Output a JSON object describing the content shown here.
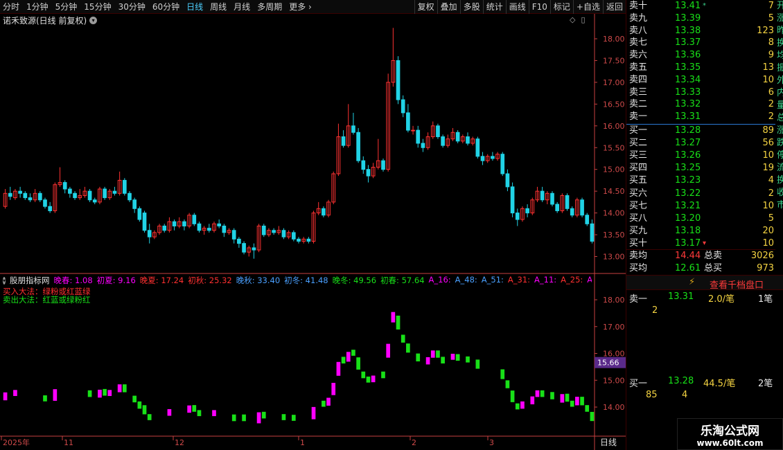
{
  "toolbar": {
    "periods": [
      "分时",
      "1分钟",
      "5分钟",
      "15分钟",
      "30分钟",
      "60分钟",
      "日线",
      "周线",
      "月线",
      "多周期",
      "更多"
    ],
    "more_arrow": "›",
    "active_period": "日线",
    "buttons": [
      "复权",
      "叠加",
      "多股",
      "统计",
      "画线",
      "F10",
      "标记",
      "+自选",
      "返回"
    ]
  },
  "stock": {
    "title": "诺禾致源(日线 前复权)"
  },
  "colors": {
    "up": "#ff3232",
    "down": "#21d3e6",
    "grid": "#3a0000",
    "axis": "#c94040",
    "magenta": "#ff00ff",
    "green": "#18e018",
    "blue": "#4aa0ff",
    "price_highlight": "#5a2a8a"
  },
  "price_axis": {
    "labels": [
      "18.00",
      "17.50",
      "17.00",
      "16.50",
      "16.00",
      "15.50",
      "15.00",
      "14.50",
      "14.00",
      "13.50",
      "13.00"
    ]
  },
  "indicator_axis": {
    "labels": [
      "18.00",
      "17.00",
      "16.00",
      "15.00",
      "14.00"
    ],
    "highlight": "15.66"
  },
  "date_axis": {
    "labels": [
      "2025年",
      "11",
      "12",
      "1",
      "2",
      "3"
    ],
    "corner": "日线"
  },
  "indicator": {
    "name": "股朋指标网",
    "params": [
      {
        "label": "晚春:",
        "value": "1.08",
        "color": "#ff00ff"
      },
      {
        "label": "初夏:",
        "value": "9.16",
        "color": "#ff00ff"
      },
      {
        "label": "晚夏:",
        "value": "17.24",
        "color": "#ff3030"
      },
      {
        "label": "初秋:",
        "value": "25.32",
        "color": "#ff3030"
      },
      {
        "label": "晚秋:",
        "value": "33.40",
        "color": "#4aa0ff"
      },
      {
        "label": "初冬:",
        "value": "41.48",
        "color": "#4aa0ff"
      },
      {
        "label": "晚冬:",
        "value": "49.56",
        "color": "#18e018"
      },
      {
        "label": "初春:",
        "value": "57.64",
        "color": "#18e018"
      },
      {
        "label": "A_16:",
        "value": "",
        "color": "#ff00ff"
      },
      {
        "label": "A_48:",
        "value": "",
        "color": "#4aa0ff"
      },
      {
        "label": "A_51:",
        "value": "",
        "color": "#4aa0ff"
      },
      {
        "label": "A_31:",
        "value": "",
        "color": "#ff3030"
      },
      {
        "label": "A_11:",
        "value": "",
        "color": "#ff00ff"
      },
      {
        "label": "A_25:",
        "value": "",
        "color": "#ff3030"
      },
      {
        "label": "A_32:",
        "value": "",
        "color": "#ff00ff"
      },
      {
        "label": "A",
        "value": "",
        "color": "#4aa0ff"
      }
    ],
    "buy_rule": "买入大法：绿粉或红蓝绿",
    "sell_rule": "卖出大法：红蓝或绿粉红"
  },
  "orderbook": {
    "asks": [
      {
        "label": "卖十",
        "price": "13.41",
        "vol": "7",
        "mark": "*"
      },
      {
        "label": "卖九",
        "price": "13.39",
        "vol": "5"
      },
      {
        "label": "卖八",
        "price": "13.38",
        "vol": "123"
      },
      {
        "label": "卖七",
        "price": "13.37",
        "vol": "8"
      },
      {
        "label": "卖六",
        "price": "13.36",
        "vol": "9"
      },
      {
        "label": "卖五",
        "price": "13.35",
        "vol": "13"
      },
      {
        "label": "卖四",
        "price": "13.34",
        "vol": "10"
      },
      {
        "label": "卖三",
        "price": "13.33",
        "vol": "6"
      },
      {
        "label": "卖二",
        "price": "13.32",
        "vol": "2"
      },
      {
        "label": "卖一",
        "price": "13.31",
        "vol": "2"
      }
    ],
    "bids": [
      {
        "label": "买一",
        "price": "13.28",
        "vol": "89"
      },
      {
        "label": "买二",
        "price": "13.27",
        "vol": "56"
      },
      {
        "label": "买三",
        "price": "13.26",
        "vol": "10"
      },
      {
        "label": "买四",
        "price": "13.25",
        "vol": "19"
      },
      {
        "label": "买五",
        "price": "13.23",
        "vol": "4"
      },
      {
        "label": "买六",
        "price": "13.22",
        "vol": "2"
      },
      {
        "label": "买七",
        "price": "13.21",
        "vol": "10"
      },
      {
        "label": "买八",
        "price": "13.20",
        "vol": "5"
      },
      {
        "label": "买九",
        "price": "13.18",
        "vol": "20"
      },
      {
        "label": "买十",
        "price": "13.17",
        "vol": "10",
        "mark": "▾"
      }
    ],
    "summary": {
      "sell_avg_label": "卖均",
      "sell_avg": "14.44",
      "sell_total_label": "总卖",
      "sell_total": "3026",
      "buy_avg_label": "买均",
      "buy_avg": "12.61",
      "buy_total_label": "总买",
      "buy_total": "973"
    },
    "side_strip": "开涨昨换均振外内量总涨跌停流换收市",
    "side_strip_bottom": "5"
  },
  "qiandang": {
    "label": "查看千档盘口",
    "icon": "lightning-icon"
  },
  "queue": {
    "sell1": {
      "label": "卖一",
      "price": "13.31",
      "avg": "2.0/笔",
      "count": "1笔",
      "orders": [
        "2"
      ]
    },
    "buy1": {
      "label": "买一",
      "price": "13.28",
      "avg": "44.5/笔",
      "count": "2笔",
      "orders": [
        "85",
        "4"
      ]
    }
  },
  "watermark": {
    "line1": "乐淘公式网",
    "line2": "www.60lt.com"
  },
  "chart_data": {
    "type": "candlestick",
    "price_range": [
      12.85,
      18.3
    ],
    "candles": [
      [
        14.15,
        14.45,
        14.55,
        14.1
      ],
      [
        14.45,
        14.38,
        14.6,
        14.3
      ],
      [
        14.35,
        14.5,
        14.55,
        14.3
      ],
      [
        14.5,
        14.45,
        14.6,
        14.35
      ],
      [
        14.45,
        14.35,
        14.5,
        14.3
      ],
      [
        14.35,
        14.3,
        14.45,
        14.25
      ],
      [
        14.3,
        14.45,
        14.55,
        14.25
      ],
      [
        14.45,
        14.3,
        14.5,
        14.25
      ],
      [
        14.3,
        14.15,
        14.35,
        14.1
      ],
      [
        14.15,
        14.05,
        14.25,
        14.0
      ],
      [
        14.05,
        14.65,
        14.7,
        14.0
      ],
      [
        14.65,
        14.7,
        15.05,
        14.6
      ],
      [
        14.7,
        14.55,
        14.75,
        14.45
      ],
      [
        14.55,
        14.45,
        14.6,
        14.35
      ],
      [
        14.45,
        14.35,
        14.5,
        14.3
      ],
      [
        14.35,
        14.4,
        14.55,
        14.3
      ],
      [
        14.4,
        14.5,
        14.6,
        14.35
      ],
      [
        14.5,
        14.3,
        14.55,
        14.25
      ],
      [
        14.3,
        14.25,
        14.35,
        14.2
      ],
      [
        14.25,
        14.55,
        14.6,
        14.2
      ],
      [
        14.55,
        14.35,
        14.6,
        14.3
      ],
      [
        14.35,
        14.5,
        14.55,
        14.3
      ],
      [
        14.5,
        14.45,
        14.6,
        14.4
      ],
      [
        14.45,
        14.75,
        14.95,
        14.4
      ],
      [
        14.75,
        14.45,
        14.8,
        14.4
      ],
      [
        14.45,
        14.3,
        14.5,
        14.25
      ],
      [
        14.3,
        14.1,
        14.35,
        14.0
      ],
      [
        14.1,
        13.85,
        14.15,
        13.8
      ],
      [
        14.0,
        13.6,
        14.05,
        13.55
      ],
      [
        13.6,
        13.45,
        13.75,
        13.3
      ],
      [
        13.45,
        13.55,
        13.6,
        13.4
      ],
      [
        13.55,
        13.7,
        13.75,
        13.5
      ],
      [
        13.7,
        13.6,
        13.75,
        13.55
      ],
      [
        13.6,
        13.8,
        13.9,
        13.55
      ],
      [
        13.8,
        13.7,
        13.85,
        13.6
      ],
      [
        13.7,
        13.8,
        13.9,
        13.65
      ],
      [
        13.8,
        13.7,
        13.85,
        13.6
      ],
      [
        13.7,
        13.95,
        14.0,
        13.65
      ],
      [
        13.95,
        13.75,
        14.0,
        13.7
      ],
      [
        13.75,
        13.6,
        13.8,
        13.55
      ],
      [
        13.6,
        13.65,
        13.7,
        13.5
      ],
      [
        13.65,
        13.6,
        13.75,
        13.55
      ],
      [
        13.6,
        13.75,
        13.8,
        13.55
      ],
      [
        13.75,
        13.7,
        13.85,
        13.65
      ],
      [
        13.7,
        13.55,
        13.75,
        13.45
      ],
      [
        13.55,
        13.6,
        13.65,
        13.5
      ],
      [
        13.6,
        13.4,
        13.65,
        13.3
      ],
      [
        13.4,
        13.3,
        13.45,
        13.2
      ],
      [
        13.3,
        13.1,
        13.35,
        13.05
      ],
      [
        13.1,
        13.2,
        13.25,
        13.0
      ],
      [
        13.2,
        13.15,
        13.3,
        12.95
      ],
      [
        13.15,
        13.7,
        13.75,
        13.1
      ],
      [
        13.7,
        13.5,
        13.75,
        13.45
      ],
      [
        13.5,
        13.6,
        13.65,
        13.45
      ],
      [
        13.6,
        13.55,
        13.65,
        13.5
      ],
      [
        13.55,
        13.6,
        13.7,
        13.5
      ],
      [
        13.6,
        13.45,
        13.65,
        13.4
      ],
      [
        13.45,
        13.55,
        13.6,
        13.4
      ],
      [
        13.55,
        13.4,
        13.6,
        13.35
      ],
      [
        13.4,
        13.35,
        13.45,
        13.3
      ],
      [
        13.35,
        13.4,
        13.45,
        13.3
      ],
      [
        13.4,
        13.35,
        13.45,
        13.3
      ],
      [
        13.35,
        14.0,
        14.05,
        13.3
      ],
      [
        14.0,
        14.1,
        14.25,
        13.95
      ],
      [
        14.1,
        13.95,
        14.15,
        13.9
      ],
      [
        13.95,
        14.25,
        14.3,
        13.9
      ],
      [
        14.25,
        14.9,
        14.95,
        14.2
      ],
      [
        14.9,
        15.75,
        16.05,
        14.85
      ],
      [
        15.75,
        15.55,
        15.9,
        15.5
      ],
      [
        15.55,
        16.0,
        16.5,
        15.5
      ],
      [
        16.0,
        15.85,
        16.3,
        15.8
      ],
      [
        15.85,
        15.2,
        15.95,
        15.15
      ],
      [
        15.2,
        15.0,
        15.3,
        14.9
      ],
      [
        15.0,
        14.85,
        15.1,
        14.7
      ],
      [
        14.85,
        15.05,
        15.15,
        14.8
      ],
      [
        15.05,
        15.2,
        15.7,
        15.0
      ],
      [
        15.2,
        15.0,
        15.25,
        14.95
      ],
      [
        15.0,
        17.0,
        17.2,
        14.95
      ],
      [
        17.0,
        17.5,
        18.25,
        16.9
      ],
      [
        17.5,
        16.6,
        17.6,
        16.5
      ],
      [
        16.6,
        16.3,
        16.7,
        16.2
      ],
      [
        16.3,
        15.9,
        16.5,
        15.85
      ],
      [
        15.9,
        15.9,
        16.0,
        15.8
      ],
      [
        15.9,
        15.6,
        16.0,
        15.5
      ],
      [
        15.6,
        15.5,
        15.7,
        15.4
      ],
      [
        15.5,
        15.75,
        15.85,
        15.45
      ],
      [
        15.75,
        16.0,
        16.1,
        15.7
      ],
      [
        16.0,
        15.75,
        16.05,
        15.7
      ],
      [
        15.75,
        15.55,
        15.8,
        15.5
      ],
      [
        15.55,
        15.7,
        15.8,
        15.5
      ],
      [
        15.7,
        15.85,
        15.95,
        15.65
      ],
      [
        15.85,
        15.65,
        15.9,
        15.6
      ],
      [
        15.65,
        15.75,
        15.8,
        15.6
      ],
      [
        15.75,
        15.6,
        15.85,
        15.55
      ],
      [
        15.6,
        15.7,
        15.75,
        15.55
      ],
      [
        15.7,
        15.3,
        15.75,
        15.25
      ],
      [
        15.3,
        15.2,
        15.4,
        15.1
      ],
      [
        15.2,
        15.3,
        15.35,
        15.15
      ],
      [
        15.3,
        15.25,
        15.4,
        15.2
      ],
      [
        15.25,
        15.35,
        15.4,
        15.2
      ],
      [
        15.35,
        14.9,
        15.4,
        14.85
      ],
      [
        14.9,
        14.6,
        15.0,
        14.5
      ],
      [
        14.6,
        14.0,
        14.7,
        13.9
      ],
      [
        14.0,
        13.85,
        14.1,
        13.7
      ],
      [
        13.85,
        14.1,
        14.15,
        13.8
      ],
      [
        14.1,
        14.0,
        14.2,
        13.9
      ],
      [
        14.0,
        14.3,
        14.35,
        13.95
      ],
      [
        14.3,
        14.5,
        14.6,
        14.25
      ],
      [
        14.5,
        14.3,
        14.6,
        14.25
      ],
      [
        14.3,
        14.45,
        14.5,
        14.2
      ],
      [
        14.45,
        14.2,
        14.5,
        14.15
      ],
      [
        14.2,
        14.05,
        14.25,
        14.0
      ],
      [
        14.05,
        14.4,
        14.45,
        14.0
      ],
      [
        14.4,
        14.1,
        14.45,
        14.05
      ],
      [
        14.1,
        13.95,
        14.15,
        13.9
      ],
      [
        13.95,
        14.3,
        14.35,
        13.9
      ],
      [
        14.3,
        13.95,
        14.35,
        13.9
      ],
      [
        13.95,
        13.75,
        14.0,
        13.7
      ],
      [
        13.75,
        13.35,
        13.85,
        13.3
      ]
    ]
  }
}
